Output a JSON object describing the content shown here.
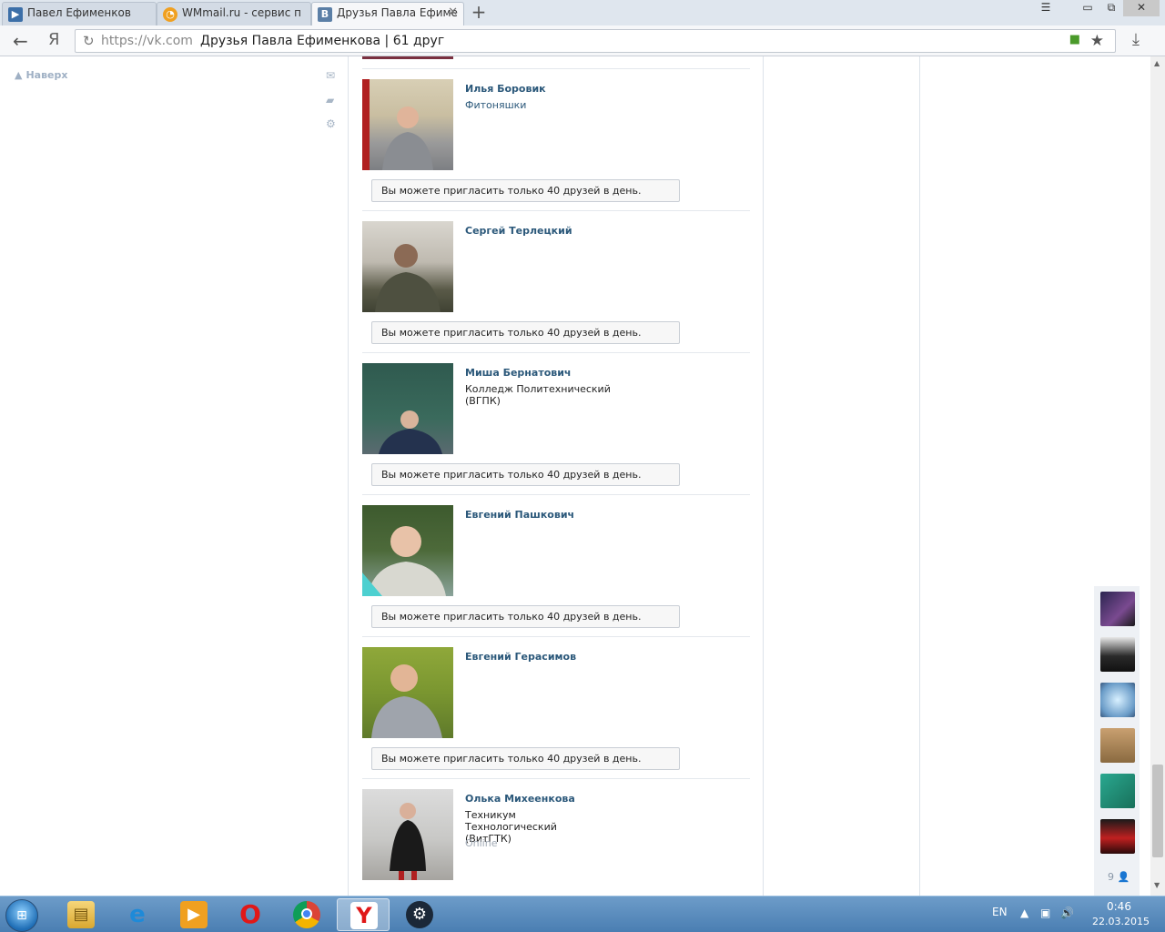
{
  "browser": {
    "tabs": [
      {
        "title": "Павел Ефименков",
        "icon": "video-play-icon"
      },
      {
        "title": "WMmail.ru - сервис п",
        "icon": "wmmail-icon"
      },
      {
        "title": "Друзья Павла Ефиме",
        "icon": "vk-icon"
      }
    ],
    "new_tab_label": "+",
    "window_buttons": {
      "menu": "☰",
      "minimize": "▭",
      "restore": "⧉",
      "close": "✕"
    },
    "address": {
      "host": "https://vk.com",
      "page_title": "Друзья Павла Ефименкова | 61 друг"
    }
  },
  "sidebar": {
    "top_button": "Наверх",
    "icons": [
      "mail-icon",
      "comment-icon",
      "gear-icon"
    ]
  },
  "friends": [
    {
      "name": "Илья Боровик",
      "subtitle": "Фитоняшки",
      "subtitle_style": "link",
      "online": "",
      "invite": "Вы можете пригласить только 40 друзей в день."
    },
    {
      "name": "Сергей Терлецкий",
      "subtitle": "",
      "subtitle_style": "",
      "online": "",
      "invite": "Вы можете пригласить только 40 друзей в день."
    },
    {
      "name": "Миша Бернатович",
      "subtitle": "Колледж Политехнический (ВГПК)",
      "subtitle_style": "dark",
      "online": "",
      "invite": "Вы можете пригласить только 40 друзей в день."
    },
    {
      "name": "Евгений Пашкович",
      "subtitle": "",
      "subtitle_style": "",
      "online": "",
      "invite": "Вы можете пригласить только 40 друзей в день."
    },
    {
      "name": "Евгений Герасимов",
      "subtitle": "",
      "subtitle_style": "",
      "online": "",
      "invite": "Вы можете пригласить только 40 друзей в день."
    },
    {
      "name": "Олька Михеенкова",
      "subtitle": "Техникум Технологический (ВитГТК)",
      "subtitle_style": "dark",
      "online": "Online",
      "invite": ""
    }
  ],
  "mini_panel": {
    "count": "9"
  },
  "taskbar": {
    "apps": [
      "explorer-icon",
      "internet-explorer-icon",
      "media-player-icon",
      "opera-icon",
      "chrome-icon",
      "yandex-browser-icon",
      "steam-icon"
    ],
    "lang": "EN",
    "time": "0:46",
    "date": "22.03.2015"
  }
}
